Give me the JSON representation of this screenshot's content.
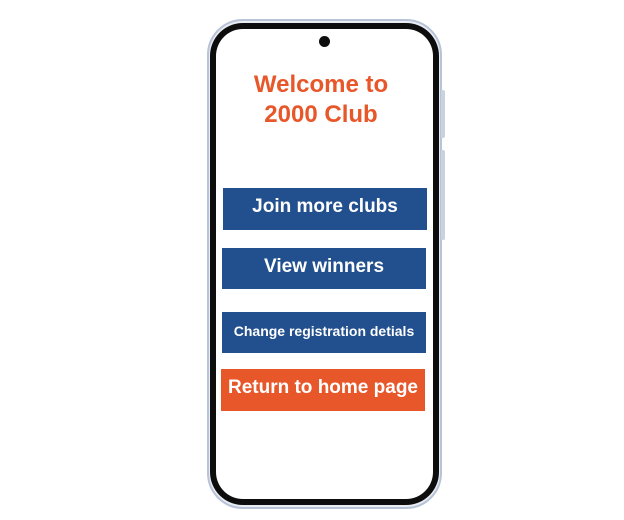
{
  "welcome": {
    "line1": "Welcome to",
    "line2": "2000 Club"
  },
  "menu": {
    "join_more_clubs": "Join more clubs",
    "view_winners": "View winners",
    "change_registration": "Change registration detials",
    "return_home": "Return to home page"
  },
  "colors": {
    "accent_orange": "#e8572a",
    "button_blue": "#22508e",
    "bezel": "#0d0d0d",
    "frame": "#e9edf3"
  },
  "icons": {
    "camera": "front-camera-icon"
  }
}
